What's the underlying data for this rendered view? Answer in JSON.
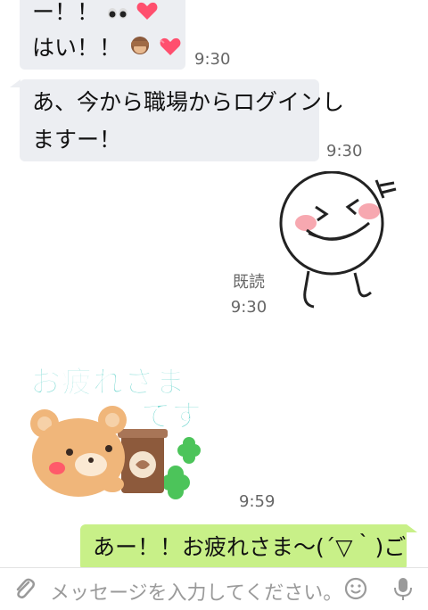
{
  "messages": [
    {
      "id": "m1",
      "direction": "incoming",
      "lines": [
        "ー！！",
        "はい！！"
      ],
      "emoji": [
        "eyes",
        "heart",
        "see-no-evil-monkey",
        "heart"
      ],
      "time": "9:30"
    },
    {
      "id": "m2",
      "direction": "incoming",
      "lines": [
        "あ、今から職場からログインし",
        "ますー！"
      ],
      "time": "9:30"
    },
    {
      "id": "m3",
      "direction": "outgoing",
      "type": "sticker",
      "sticker_name": "laughing-round-face-character",
      "read_label": "既読",
      "time": "9:30"
    },
    {
      "id": "m4",
      "direction": "incoming",
      "type": "sticker",
      "sticker_name": "bear-with-coffee-otsukaresama",
      "sticker_text_line1": "お疲れさま",
      "sticker_text_line2": "です",
      "time": "9:59"
    },
    {
      "id": "m5",
      "direction": "outgoing",
      "text": "あー！！お疲れさま〜(´▽｀)ご"
    }
  ],
  "composer": {
    "placeholder": "メッセージを入力してください。",
    "attach_icon": "paperclip-icon",
    "emoji_icon": "smiley-icon",
    "mic_icon": "microphone-icon"
  },
  "colors": {
    "incoming_bubble": "#eceef2",
    "outgoing_bubble": "#c8f088",
    "sticker_text": "#6fd6cf"
  }
}
